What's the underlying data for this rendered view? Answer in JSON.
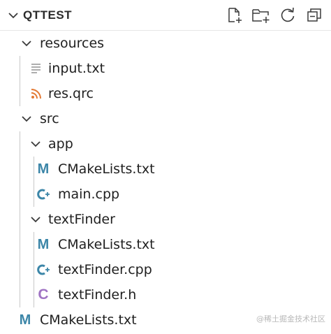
{
  "explorer": {
    "title": "QTTEST",
    "actions": [
      {
        "name": "new-file",
        "icon": "new-file-icon"
      },
      {
        "name": "new-folder",
        "icon": "new-folder-icon"
      },
      {
        "name": "refresh",
        "icon": "refresh-icon"
      },
      {
        "name": "collapse-all",
        "icon": "collapse-all-icon"
      }
    ]
  },
  "tree": {
    "resources": {
      "label": "resources",
      "children": {
        "input_txt": {
          "label": "input.txt",
          "icon": "text-file-icon"
        },
        "res_qrc": {
          "label": "res.qrc",
          "icon": "rss-icon"
        }
      }
    },
    "src": {
      "label": "src",
      "app": {
        "label": "app",
        "cmake": {
          "label": "CMakeLists.txt",
          "icon": "cmake-icon"
        },
        "main_cpp": {
          "label": "main.cpp",
          "icon": "cpp-icon"
        }
      },
      "textFinder": {
        "label": "textFinder",
        "cmake": {
          "label": "CMakeLists.txt",
          "icon": "cmake-icon"
        },
        "cpp": {
          "label": "textFinder.cpp",
          "icon": "cpp-icon"
        },
        "h": {
          "label": "textFinder.h",
          "icon": "c-header-icon"
        }
      }
    },
    "root_cmake": {
      "label": "CMakeLists.txt",
      "icon": "cmake-icon"
    }
  },
  "colors": {
    "cmake": "#3c86a8",
    "cpp": "#3c86a8",
    "header": "#a074c4",
    "rss": "#e37933",
    "text": "#9a9a9a",
    "guide": "#c8c8c8"
  },
  "watermark": "@稀土掘金技术社区"
}
